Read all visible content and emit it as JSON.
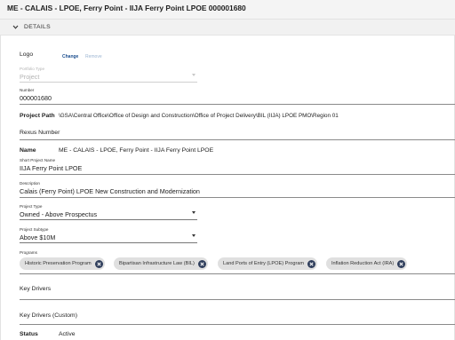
{
  "header": {
    "title": "ME - CALAIS - LPOE, Ferry Point - IIJA Ferry Point LPOE 000001680"
  },
  "section": {
    "title": "DETAILS"
  },
  "logo": {
    "label": "Logo",
    "change": "Change",
    "remove": "Remove"
  },
  "portfolio_type": {
    "label": "Portfolio Type",
    "value": "Project"
  },
  "number": {
    "label": "Number",
    "value": "000001680"
  },
  "project_path": {
    "label": "Project Path",
    "value": "\\GSA\\Central Office\\Office of Design and Construction\\Office of Project Delivery\\BIL (IIJA) LPOE PMO\\Region 01"
  },
  "rexus_number": {
    "label": "Rexus Number"
  },
  "name": {
    "label": "Name",
    "value": "ME - CALAIS - LPOE, Ferry Point - IIJA Ferry Point LPOE"
  },
  "short_project_name": {
    "label": "Short Project Name",
    "value": "IIJA Ferry Point LPOE"
  },
  "description": {
    "label": "Description",
    "value": "Calais (Ferry Point) LPOE New Construction and Modernization"
  },
  "project_type": {
    "label": "Project Type",
    "value": "Owned - Above Prospectus"
  },
  "project_subtype": {
    "label": "Project Subtype",
    "value": "Above $10M"
  },
  "programs": {
    "label": "Programs",
    "chips": [
      "Historic Preservation Program",
      "Bipartisan Infrastructure Law (BIL)",
      "Land Ports of Entry (LPOE) Program",
      "Inflation Reduction Act (IRA)"
    ]
  },
  "key_drivers": {
    "label": "Key Drivers"
  },
  "key_drivers_custom": {
    "label": "Key Drivers (Custom)"
  },
  "status": {
    "label": "Status",
    "value": "Active"
  },
  "icons": {
    "section_toggle": "chevron-down-icon",
    "chip_remove": "close-circle-icon",
    "dropdown": "caret-down-icon"
  }
}
